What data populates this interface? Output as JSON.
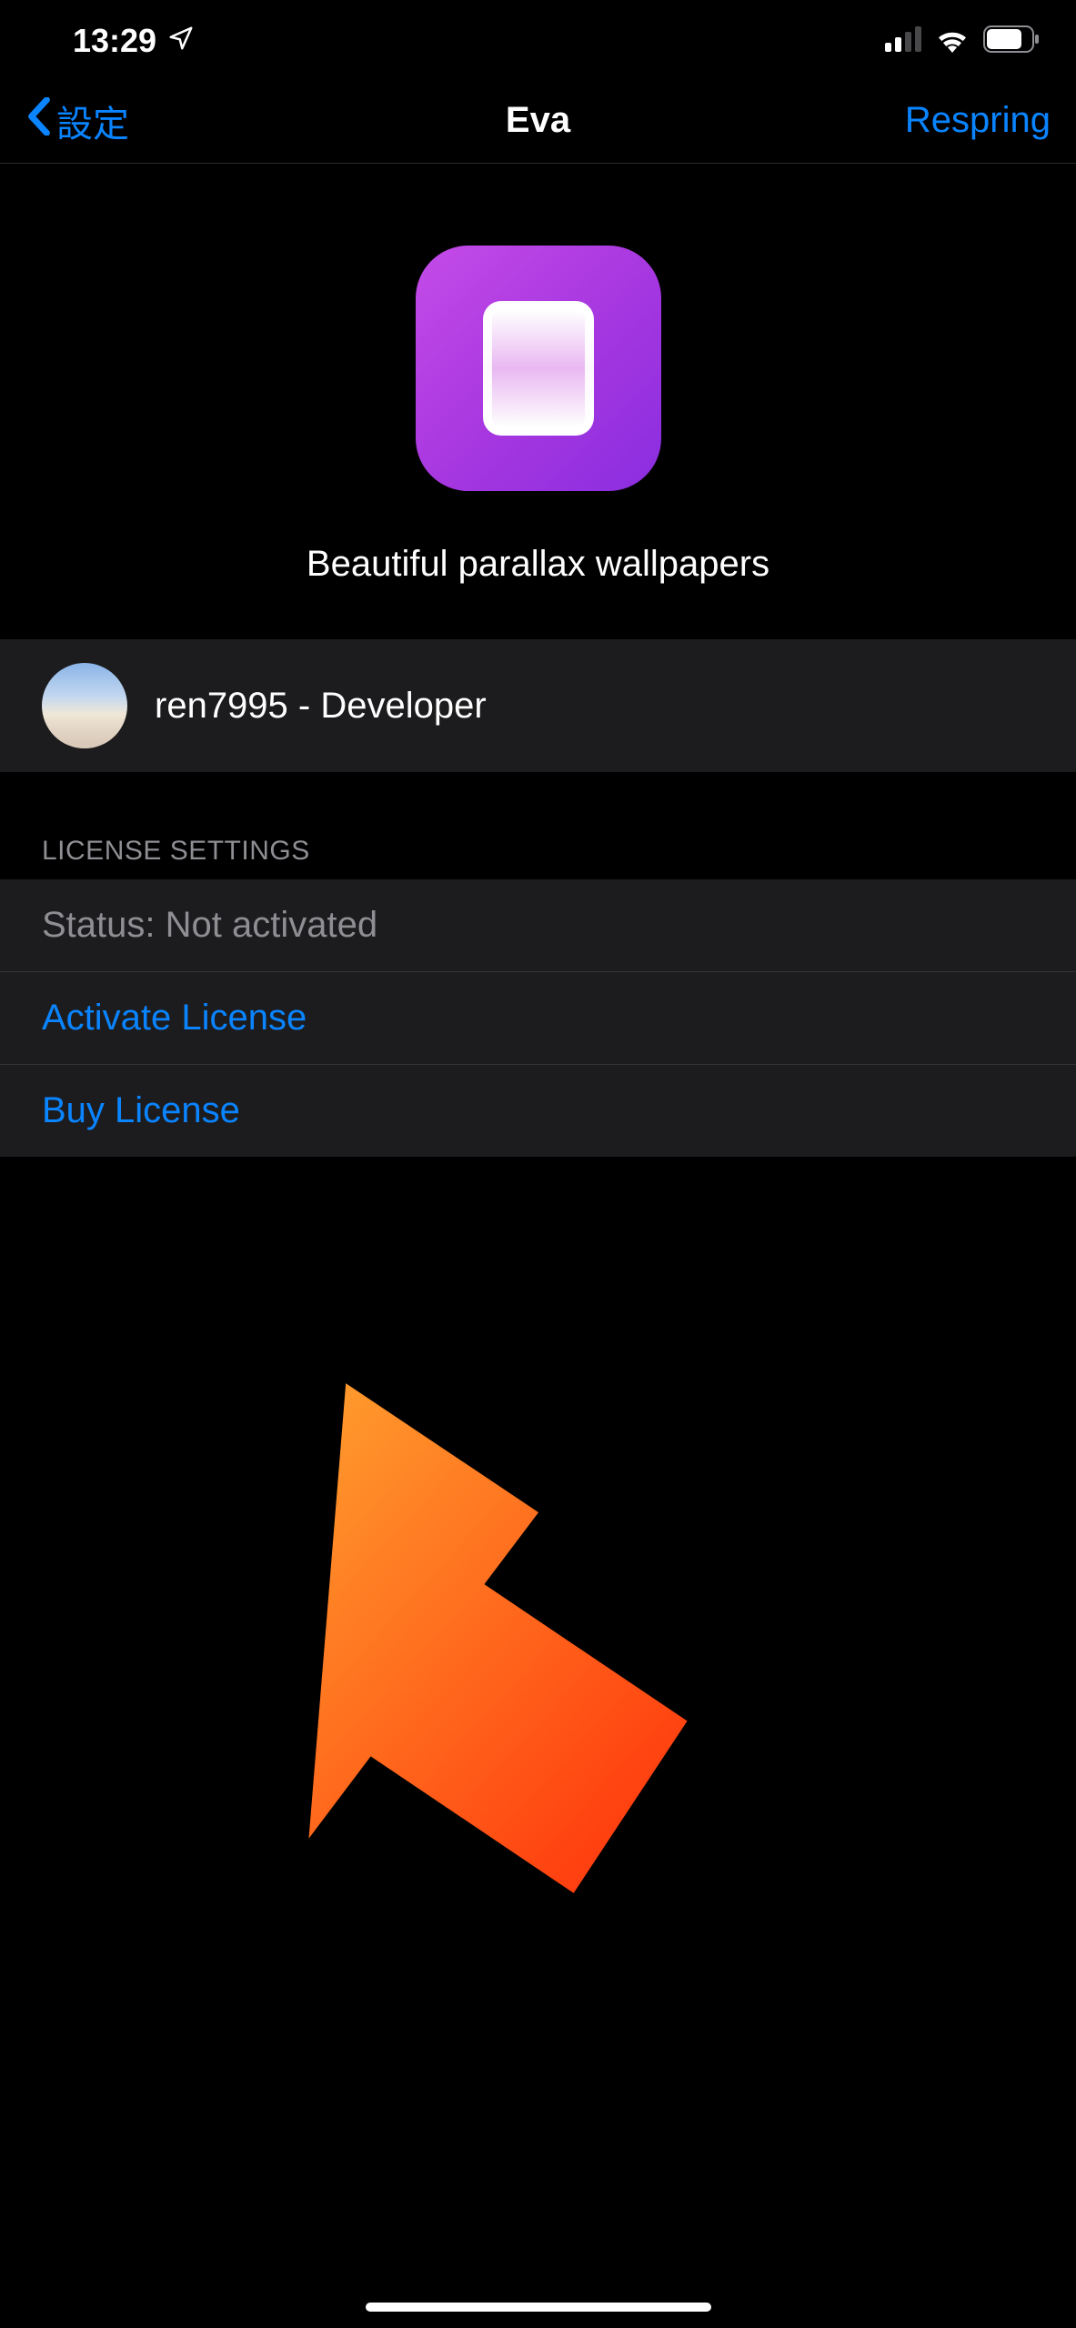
{
  "status_bar": {
    "time": "13:29"
  },
  "nav": {
    "back_label": "設定",
    "title": "Eva",
    "right_action": "Respring"
  },
  "header": {
    "subtitle": "Beautiful parallax wallpapers"
  },
  "developer": {
    "name": "ren7995 - Developer"
  },
  "license_section": {
    "header": "LICENSE SETTINGS",
    "status": "Status: Not activated",
    "activate_label": "Activate License",
    "buy_label": "Buy License"
  },
  "colors": {
    "link": "#0a84ff",
    "secondary_text": "#8e8e93",
    "row_bg": "#1c1c1e",
    "annotation_arrow_start": "#ffa530",
    "annotation_arrow_end": "#ff4010"
  }
}
